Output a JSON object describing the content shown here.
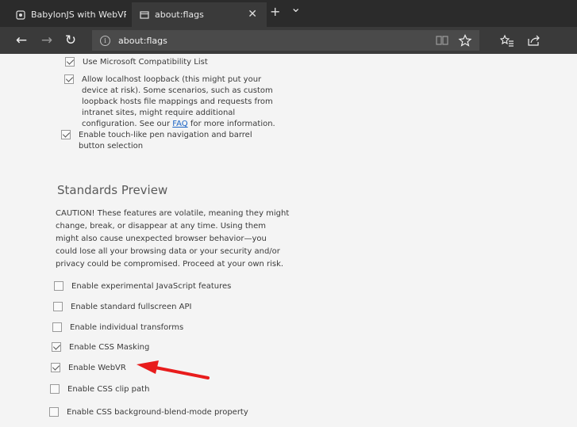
{
  "tabs": [
    {
      "title": "BabylonJS with WebVR simp",
      "active": false,
      "icon": "page-icon"
    },
    {
      "title": "about:flags",
      "active": true,
      "icon": "page-icon"
    }
  ],
  "tabbar": {
    "close_glyph": "✕",
    "new_tab_glyph": "+",
    "dropdown_glyph": "⌄"
  },
  "toolbar": {
    "back_glyph": "←",
    "forward_glyph": "→",
    "refresh_glyph": "↻",
    "url": "about:flags",
    "info_glyph": "i"
  },
  "top_options": [
    {
      "label": "Use Microsoft Compatibility List",
      "checked": true
    },
    {
      "label_before": "Allow localhost loopback (this might put your device at risk). Some scenarios, such as custom loopback hosts file mappings and requests from intranet sites, might require additional configuration. See our ",
      "link": "FAQ",
      "label_after": " for more information.",
      "checked": true
    },
    {
      "label": "Enable touch-like pen navigation and barrel button selection",
      "checked": true
    }
  ],
  "standards_preview": {
    "title": "Standards Preview",
    "caution": "CAUTION! These features are volatile, meaning they might change, break, or disappear at any time. Using them might also cause unexpected browser behavior—you could lose all your browsing data or your security and/or privacy could be compromised. Proceed at your own risk.",
    "options": [
      {
        "label": "Enable experimental JavaScript features",
        "checked": false
      },
      {
        "label": "Enable standard fullscreen API",
        "checked": false
      },
      {
        "label": "Enable individual transforms",
        "checked": false
      },
      {
        "label": "Enable CSS Masking",
        "checked": true
      },
      {
        "label": "Enable WebVR",
        "checked": true
      },
      {
        "label": "Enable CSS clip path",
        "checked": false
      },
      {
        "label": "Enable CSS background-blend-mode property",
        "checked": false
      }
    ]
  },
  "colors": {
    "accent": "#e81c1c",
    "link": "#1a64c6",
    "chrome": "#2b2b2b"
  }
}
